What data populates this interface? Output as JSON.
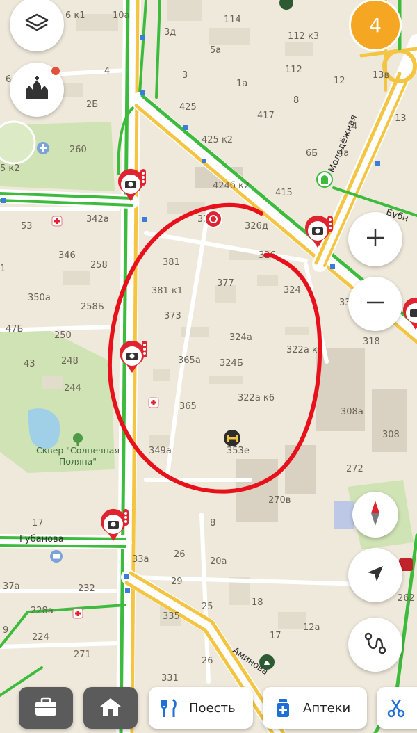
{
  "map": {
    "labels": {
      "b_6k1": "6 к1",
      "b_10a": "10а",
      "b_114": "114",
      "b_112k3": "112 к3",
      "b_3d": "3д",
      "b_5a": "5а",
      "b_6": "6",
      "b_4": "4",
      "b_3": "3",
      "b_1a": "1а",
      "b_112": "112",
      "b_12": "12",
      "b_13v": "13в",
      "b_2b": "2Б",
      "b_425": "425",
      "b_417": "417",
      "b_8": "8",
      "b_13": "13",
      "b_4top": "4",
      "b_425k2": "425 к2",
      "b_6b": "6Б",
      "b_4a": "4а",
      "b_260": "260",
      "b_5k2": "5 к2",
      "b_424bk2": "424б к2",
      "b_415": "415",
      "b_53": "53",
      "b_342a": "342а",
      "b_326d": "326д",
      "b_32_1": "32_/1",
      "b_326": "326",
      "b_346": "346",
      "b_381": "381",
      "b_258": "258",
      "b_1": "1",
      "b_381k1": "381 к1",
      "b_377": "377",
      "b_324": "324",
      "b_350a": "350а",
      "b_258b": "258Б",
      "b_373": "373",
      "b_33": "33",
      "b_318": "318",
      "b_47b": "47Б",
      "b_250": "250",
      "b_324a": "324а",
      "b_322ak": "322а к",
      "b_43": "43",
      "b_248": "248",
      "b_365a": "365а",
      "b_324b": "324Б",
      "b_244": "244",
      "b_322ak6": "322а к6",
      "b_308a": "308а",
      "b_365": "365",
      "b_308": "308",
      "b_349a": "349а",
      "b_353e": "353е",
      "b_272": "272",
      "b_270v": "270в",
      "b_17": "17",
      "b_8b": "8",
      "b_33a": "33а",
      "b_26": "26",
      "b_20a": "20а",
      "b_37a": "37а",
      "b_232": "232",
      "b_29": "29",
      "b_18": "18",
      "b_262": "262",
      "b_228a": "228а",
      "b_335": "335",
      "b_25": "25",
      "b_12a": "12а",
      "b_224": "224",
      "b_271": "271",
      "b_17b": "17",
      "b_26b": "26",
      "b_331": "331",
      "b_9": "9"
    },
    "streets": {
      "gubanova": "Губанова",
      "molodezhnaya": "Молодёжная",
      "bubn": "Бубн",
      "aminova": "Аминова"
    },
    "park_name_line1": "Сквер \"Солнечная",
    "park_name_line2": "Поляна\""
  },
  "controls": {
    "layers_icon": "layers-icon",
    "landmark_icon": "church-icon",
    "notification_count": "4",
    "zoom_in_icon": "plus-icon",
    "zoom_out_icon": "minus-icon",
    "compass_icon": "compass-icon",
    "locate_icon": "navigation-arrow-icon",
    "route_icon": "route-icon"
  },
  "bottom_bar": {
    "work_icon": "briefcase-icon",
    "home_icon": "home-icon",
    "eat_label": "Поесть",
    "pharmacy_label": "Аптеки",
    "more_icon": "scissors-icon"
  },
  "colors": {
    "traffic_green": "#3dbb3d",
    "traffic_yellow": "#f4c542",
    "annotation_red": "#e8101b",
    "badge_orange": "#f5a623",
    "camera_red": "#e0242f"
  }
}
